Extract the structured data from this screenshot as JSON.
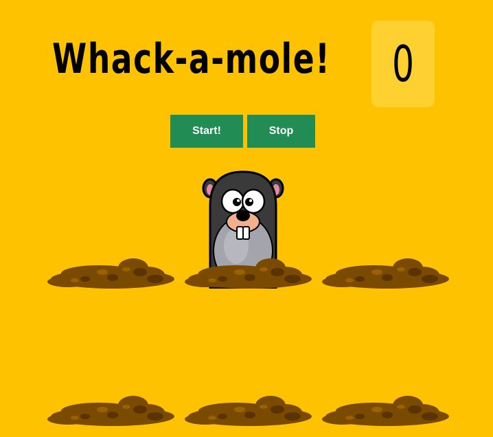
{
  "game": {
    "title": "Whack-a-mole!",
    "score": "0"
  },
  "controls": {
    "start_label": "Start!",
    "stop_label": "Stop"
  },
  "board": {
    "holes": [
      {
        "id": 1,
        "mole_up": false
      },
      {
        "id": 2,
        "mole_up": true
      },
      {
        "id": 3,
        "mole_up": false
      },
      {
        "id": 4,
        "mole_up": false
      },
      {
        "id": 5,
        "mole_up": false
      },
      {
        "id": 6,
        "mole_up": false
      }
    ]
  },
  "colors": {
    "background": "#ffc200",
    "score_box": "#ffd130",
    "button": "#218c54",
    "dirt": "#7a4a00"
  }
}
